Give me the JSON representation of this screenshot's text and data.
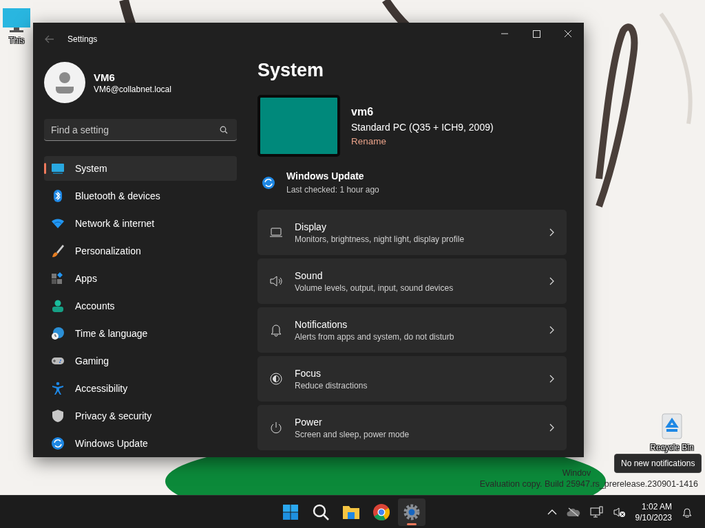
{
  "desktop_icons": [
    {
      "label": "This"
    },
    {
      "label": "Recycle Bin"
    }
  ],
  "window": {
    "title": "Settings",
    "back_disabled": true
  },
  "profile": {
    "name": "VM6",
    "email": "VM6@collabnet.local"
  },
  "search": {
    "placeholder": "Find a setting"
  },
  "nav": [
    {
      "label": "System",
      "selected": true
    },
    {
      "label": "Bluetooth & devices",
      "selected": false
    },
    {
      "label": "Network & internet",
      "selected": false
    },
    {
      "label": "Personalization",
      "selected": false
    },
    {
      "label": "Apps",
      "selected": false
    },
    {
      "label": "Accounts",
      "selected": false
    },
    {
      "label": "Time & language",
      "selected": false
    },
    {
      "label": "Gaming",
      "selected": false
    },
    {
      "label": "Accessibility",
      "selected": false
    },
    {
      "label": "Privacy & security",
      "selected": false
    },
    {
      "label": "Windows Update",
      "selected": false
    }
  ],
  "page": {
    "heading": "System",
    "device_name": "vm6",
    "device_model": "Standard PC (Q35 + ICH9, 2009)",
    "rename": "Rename",
    "update": {
      "title": "Windows Update",
      "status": "Last checked: 1 hour ago"
    },
    "cards": [
      {
        "title": "Display",
        "subtitle": "Monitors, brightness, night light, display profile"
      },
      {
        "title": "Sound",
        "subtitle": "Volume levels, output, input, sound devices"
      },
      {
        "title": "Notifications",
        "subtitle": "Alerts from apps and system, do not disturb"
      },
      {
        "title": "Focus",
        "subtitle": "Reduce distractions"
      },
      {
        "title": "Power",
        "subtitle": "Screen and sleep, power mode"
      }
    ]
  },
  "watermark": [
    "Windov",
    "Evaluation copy. Build 25947.rs_prerelease.230901-1416"
  ],
  "tooltip": "No new notifications",
  "taskbar": {
    "items": [
      {
        "selected": false
      },
      {
        "selected": false
      },
      {
        "selected": false
      },
      {
        "selected": false
      },
      {
        "selected": true
      }
    ],
    "time": "1:02 AM",
    "date": "9/10/2023"
  }
}
